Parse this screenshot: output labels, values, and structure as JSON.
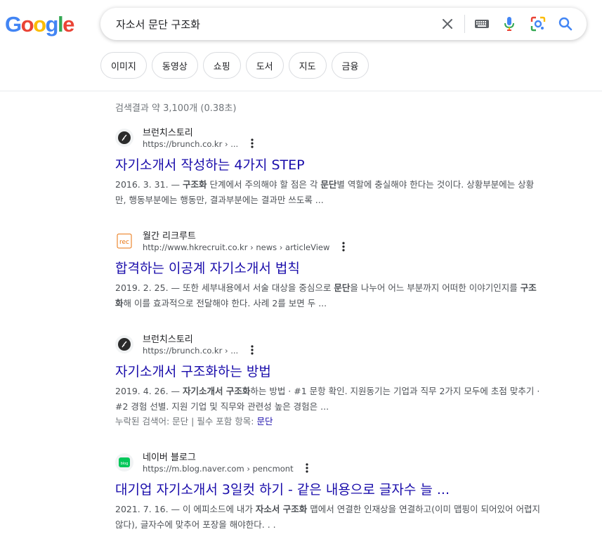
{
  "logo": {
    "letters": [
      "G",
      "o",
      "o",
      "g",
      "l",
      "e"
    ],
    "colors": [
      "#4285F4",
      "#EA4335",
      "#FBBC05",
      "#4285F4",
      "#34A853",
      "#EA4335"
    ]
  },
  "search": {
    "query": "자소서 문단 구조화"
  },
  "icons": {
    "clear": "close-icon",
    "keyboard": "keyboard-icon",
    "voice": "microphone-icon",
    "lens": "lens-icon",
    "search": "search-icon"
  },
  "chips": [
    "이미지",
    "동영상",
    "쇼핑",
    "도서",
    "지도",
    "금융"
  ],
  "stats": "검색결과 약 3,100개 (0.38초)",
  "results": [
    {
      "site_name": "브런치스토리",
      "url": "https://brunch.co.kr › ...",
      "title": "자기소개서 작성하는 4가지 STEP",
      "date": "2016. 3. 31. — ",
      "snippet_parts": [
        {
          "t": "",
          "b": "구조화"
        },
        {
          "t": " 단계에서 주의해야 할 점은 각 ",
          "b": "문단"
        },
        {
          "t": "별 역할에 충실해야 한다는 것이다. 상황부분에는 상황만, 행동부분에는 행동만, 결과부분에는 결과만 쓰도록 ...",
          "b": ""
        }
      ]
    },
    {
      "site_name": "월간 리크루트",
      "url": "http://www.hkrecruit.co.kr › news › articleView",
      "title": "합격하는 이공계 자기소개서 법칙",
      "date": "2019. 2. 25. — ",
      "snippet_parts": [
        {
          "t": "또한 세부내용에서 서술 대상을 중심으로 ",
          "b": "문단"
        },
        {
          "t": "을 나누어 어느 부분까지 어떠한 이야기인지를 ",
          "b": "구조화"
        },
        {
          "t": "해 이를 효과적으로 전달해야 한다. 사례 2를 보면 두 ...",
          "b": ""
        }
      ]
    },
    {
      "site_name": "브런치스토리",
      "url": "https://brunch.co.kr › ...",
      "title": "자기소개서 구조화하는 방법",
      "date": "2019. 4. 26. — ",
      "snippet_parts": [
        {
          "t": "",
          "b": "자기소개서 구조화"
        },
        {
          "t": "하는 방법 · #1 문항 확인. 지원동기는 기업과 직무 2가지 모두에 초점 맞추기 · #2 경험 선별. 지원 기업 및 직무와 관련성 높은 경험은 ...",
          "b": ""
        }
      ],
      "missing": {
        "label": "누락된 검색어: 문단 | 필수 포함 항목: ",
        "required": "문단"
      }
    },
    {
      "site_name": "네이버 블로그",
      "url": "https://m.blog.naver.com › pencmont",
      "title": "대기업 자기소개서 3일컷 하기 - 같은 내용으로 글자수 늘 ...",
      "date": "2021. 7. 16. — ",
      "snippet_parts": [
        {
          "t": "이 에피소드에 내가 ",
          "b": "자소서 구조화"
        },
        {
          "t": " 맵에서 연결한 인재상을 연결하고(이미 맵핑이 되어있어 어렵지 않다), 글자수에 맞추어 포장을 해야한다. . .",
          "b": ""
        }
      ]
    }
  ]
}
